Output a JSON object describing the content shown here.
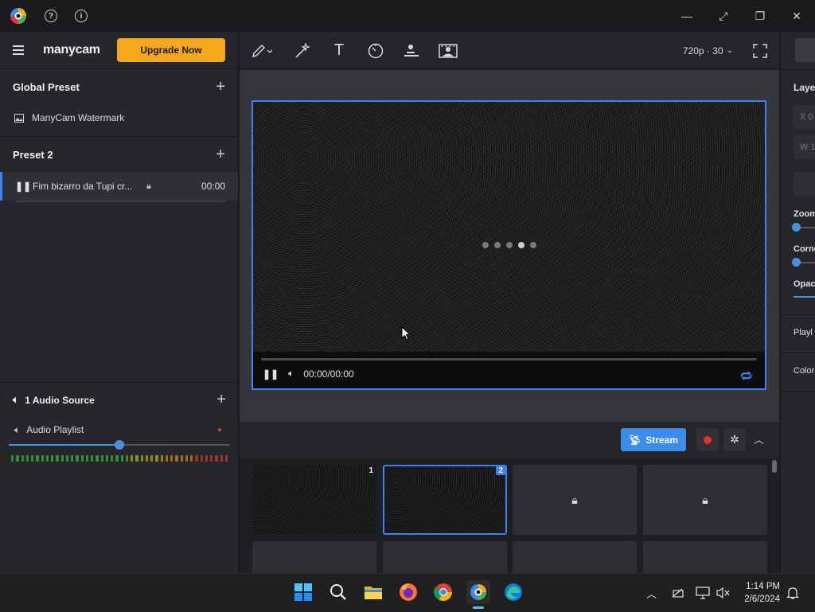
{
  "window": {
    "help_glyph": "?",
    "info_glyph": "i",
    "controls": [
      "—",
      "⤢",
      "❐",
      "✕"
    ]
  },
  "header": {
    "brand": "manycam",
    "upgrade_label": "Upgrade Now",
    "resolution": "720p · 30"
  },
  "presets": {
    "global_title": "Global Preset",
    "global_item": "ManyCam Watermark",
    "preset2_title": "Preset 2",
    "preset2_item": "Fim bizarro da Tupi cr...",
    "preset2_time": "00:00",
    "add_glyph": "+"
  },
  "audio": {
    "section_title": "1 Audio Source",
    "item_label": "Audio Playlist",
    "volume": 0.5
  },
  "player": {
    "time": "00:00/00:00",
    "progress": 0.0
  },
  "bottom_bar": {
    "stream_label": "Stream"
  },
  "scenes": [
    {
      "num": "1",
      "state": "video"
    },
    {
      "num": "2",
      "state": "video-selected"
    },
    {
      "num": "",
      "state": "locked"
    },
    {
      "num": "",
      "state": "locked"
    }
  ],
  "right_panel": {
    "layer_label": "Laye",
    "x_field": "X  0",
    "w_field": "W  1",
    "zoom_label": "Zoom",
    "corner_label": "Corne",
    "opacity_label": "Opac",
    "playlist_label": "Playl",
    "color_label": "Color"
  },
  "taskbar": {
    "time": "1:14 PM",
    "date": "2/6/2024"
  },
  "colors": {
    "accent": "#3b82f6",
    "upgrade": "#f5a81c",
    "stream": "#3a8eea",
    "record": "#e03030"
  }
}
